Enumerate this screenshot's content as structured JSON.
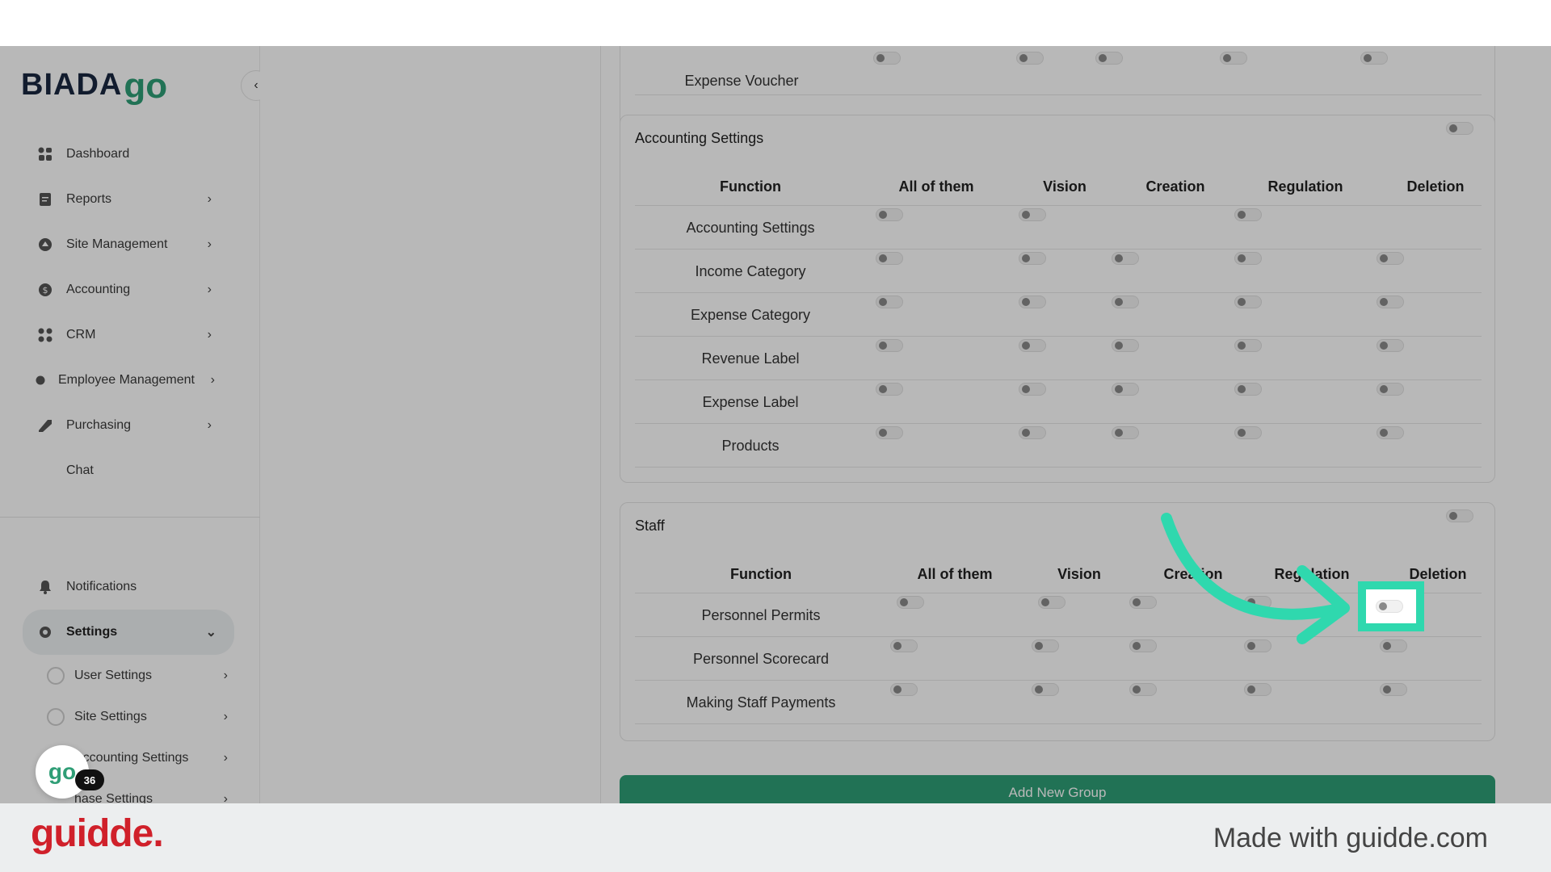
{
  "sidebar": {
    "logo": {
      "text": "BIADA",
      "go": "go"
    },
    "collapse_icon": "chevron-left-icon",
    "items": [
      {
        "label": "Dashboard",
        "icon": "dashboard-icon",
        "has_chevron": false
      },
      {
        "label": "Reports",
        "icon": "reports-icon",
        "has_chevron": true
      },
      {
        "label": "Site Management",
        "icon": "site-icon",
        "has_chevron": true
      },
      {
        "label": "Accounting",
        "icon": "dollar-icon",
        "has_chevron": true
      },
      {
        "label": "CRM",
        "icon": "crm-icon",
        "has_chevron": true
      },
      {
        "label": "Employee Management",
        "icon": "employee-icon",
        "has_chevron": true
      },
      {
        "label": "Purchasing",
        "icon": "purchasing-icon",
        "has_chevron": true
      },
      {
        "label": "Chat",
        "icon": "",
        "has_chevron": false
      }
    ],
    "bottom": {
      "notifications": "Notifications",
      "settings": "Settings",
      "sub_items": [
        "User Settings",
        "Site Settings",
        "Accounting Settings",
        "hase Settings"
      ]
    },
    "bubble": {
      "text": "go",
      "badge": "36"
    }
  },
  "main": {
    "expense_voucher_row": "Expense Voucher",
    "accounting_card": {
      "title": "Accounting Settings",
      "headers": [
        "Function",
        "All of them",
        "Vision",
        "Creation",
        "Regulation",
        "Deletion"
      ],
      "rows": [
        "Accounting Settings",
        "Income Category",
        "Expense Category",
        "Revenue Label",
        "Expense Label",
        "Products"
      ]
    },
    "staff_card": {
      "title": "Staff",
      "headers": [
        "Function",
        "All of them",
        "Vision",
        "Creation",
        "Regulation",
        "Deletion"
      ],
      "rows": [
        "Personnel Permits",
        "Personnel Scorecard",
        "Making Staff Payments"
      ]
    },
    "add_button": "Add New Group"
  },
  "overlay": {
    "accent": "#2fd8ae"
  },
  "footer": {
    "logo": "guidde.",
    "made_with": "Made with guidde.com"
  }
}
